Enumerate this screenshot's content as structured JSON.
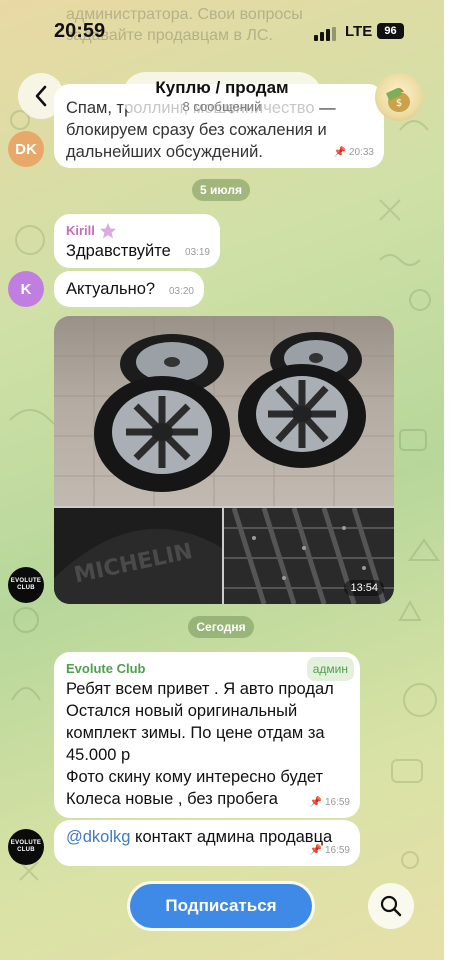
{
  "status_bar": {
    "time": "20:59",
    "network": "LTE",
    "battery": "96"
  },
  "header": {
    "title": "Куплю / продам",
    "subtitle": "8 сообщений",
    "back_icon": "chevron-left-icon",
    "avatar_icon": "money-bag-icon"
  },
  "ghost_text": "администратора. Свои вопросы задавайте продавцам в ЛС.",
  "messages": {
    "rules": {
      "avatar_initials": "DK",
      "avatar_color": "#e8a86a",
      "text": "Спам, троллинг, мошенничество — блокируем сразу без сожаления и дальнейших обсуждений.",
      "time": "20:33",
      "pinned": true
    },
    "date1": "5 июля",
    "kirill1": {
      "sender": "Kirill",
      "sender_color": "#c36fb5",
      "text": "Здравствуйте",
      "time": "03:19"
    },
    "kirill2": {
      "avatar_initial": "K",
      "avatar_color": "#c07ee0",
      "text": "Актуально?",
      "time": "03:20"
    },
    "photos": {
      "time": "13:54"
    },
    "date2": "Сегодня",
    "admin1": {
      "sender": "Evolute Club",
      "sender_color": "#4fa04d",
      "badge": "админ",
      "lines": [
        "Ребят всем привет . Я авто продал",
        "Остался новый оригинальный",
        "комплект зимы. По цене отдам за",
        "45.000 р",
        "Фото скину кому интересно будет",
        "Колеса новые , без пробега"
      ],
      "time": "16:59"
    },
    "admin2": {
      "mention": "@dkolkg",
      "text": "контакт админа продавца",
      "time": "16:59"
    },
    "club_avatar_text": [
      "EVOLUTE",
      "CLUB"
    ]
  },
  "bottom": {
    "subscribe_label": "Подписаться",
    "search_icon": "search-icon"
  },
  "colors": {
    "accent": "#3f8ae6",
    "bubble": "#ffffff",
    "mention": "#3f7ac0"
  }
}
